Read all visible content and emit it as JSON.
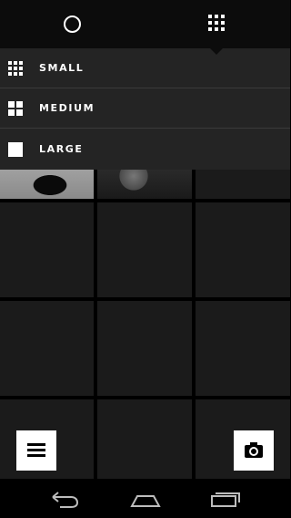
{
  "top_bar": {
    "left_icon": "circle-icon",
    "right_icon": "grid-icon"
  },
  "size_menu": {
    "items": [
      {
        "label": "SMALL",
        "icon": "grid-small-icon"
      },
      {
        "label": "MEDIUM",
        "icon": "grid-medium-icon"
      },
      {
        "label": "LARGE",
        "icon": "grid-large-icon"
      }
    ]
  },
  "floating": {
    "menu_icon": "hamburger-icon",
    "camera_icon": "camera-icon"
  },
  "nav_bar": {
    "back_icon": "back-icon",
    "home_icon": "home-icon",
    "recents_icon": "recents-icon"
  },
  "colors": {
    "background": "#000000",
    "tile": "#1b1b1b",
    "menu": "#242424",
    "accent": "#ffffff"
  }
}
